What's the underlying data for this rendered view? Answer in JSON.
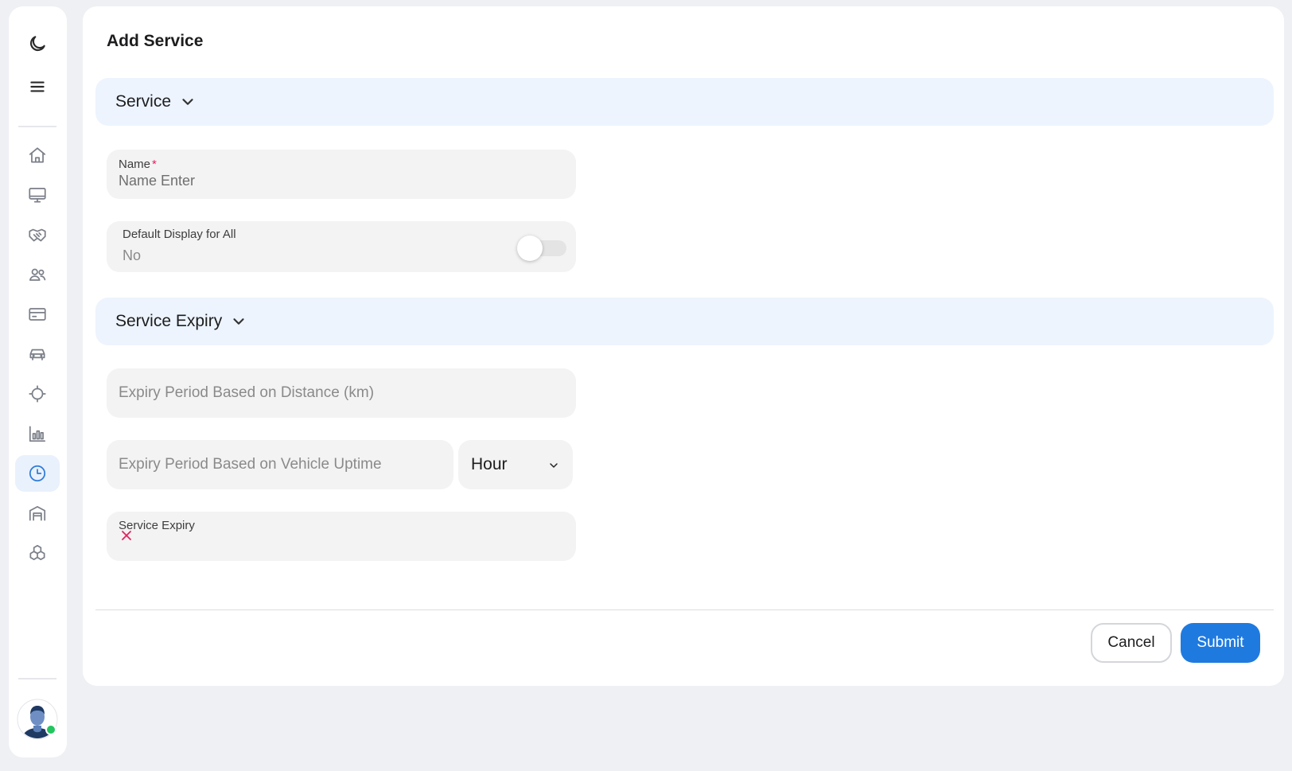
{
  "sidebar": {
    "icons": [
      "moon-icon",
      "menu-icon",
      "home-icon",
      "monitor-icon",
      "handshake-icon",
      "users-icon",
      "card-icon",
      "car-icon",
      "crosshair-icon",
      "bar-chart-icon",
      "clock-icon",
      "garage-icon",
      "boxes-icon"
    ],
    "active": "clock-icon",
    "user_status_color": "#22c55e"
  },
  "page": {
    "title": "Add Service"
  },
  "sections": {
    "service": {
      "title": "Service",
      "name_field": {
        "label": "Name",
        "required_mark": "*",
        "value": "Name Enter"
      },
      "default_display": {
        "label": "Default Display for All",
        "value": "No",
        "toggle_on": false
      }
    },
    "service_expiry": {
      "title": "Service Expiry",
      "distance_field": {
        "placeholder": "Expiry Period Based on Distance (km)"
      },
      "uptime_field": {
        "placeholder": "Expiry Period Based on Vehicle Uptime"
      },
      "uptime_unit": {
        "selected": "Hour"
      },
      "expiry_field": {
        "label": "Service Expiry"
      }
    }
  },
  "actions": {
    "cancel_label": "Cancel",
    "submit_label": "Submit"
  },
  "colors": {
    "accent": "#1f7ae0",
    "section_bg": "#edf4fd",
    "required": "#e0245e",
    "page_bg": "#eff0f4"
  }
}
